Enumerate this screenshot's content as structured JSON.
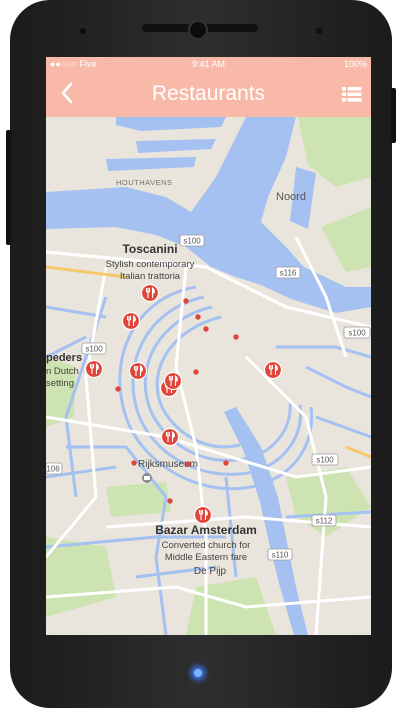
{
  "status_bar": {
    "carrier": "●●○○○ Five",
    "time": "9:41 AM",
    "battery": "100%"
  },
  "app_bar": {
    "back_icon": "chevron-left-icon",
    "title": "Restaurants",
    "list_icon": "list-view-icon"
  },
  "map": {
    "districts": [
      "HOUTHAVENS",
      "Noord"
    ],
    "roads": [
      "s100",
      "s116",
      "s100",
      "s100",
      "s100",
      "s112",
      "s110",
      "106"
    ],
    "places": [
      {
        "name": "Toscanini",
        "desc1": "Stylish contemporary",
        "desc2": "Italian trattoria"
      },
      {
        "name": "Rijksmuseum"
      },
      {
        "name": "Bazar Amsterdam",
        "desc1": "Converted church for",
        "desc2": "Middle Eastern fare"
      }
    ],
    "neighborhood": "De Pijp",
    "edge_place": {
      "name": "peders",
      "desc1": "n Dutch",
      "desc2": "setting"
    }
  },
  "colors": {
    "app_bar": "#f8b9a8",
    "marker": "#e0453a",
    "water": "#a4c1f2",
    "land": "#e9e5dc"
  }
}
